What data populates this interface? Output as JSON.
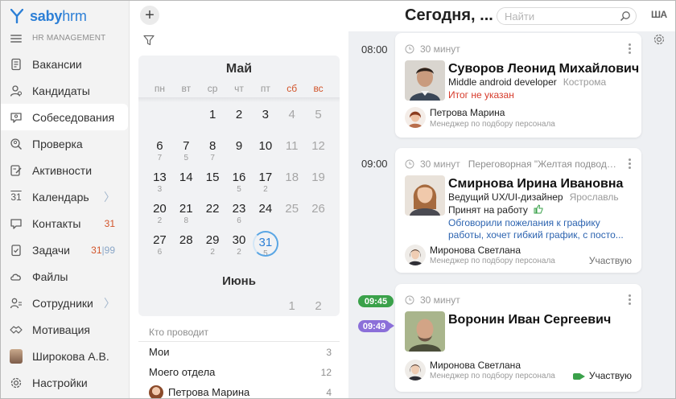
{
  "brand": {
    "name_bold": "saby",
    "name_rest": "hrm",
    "section": "HR MANAGEMENT",
    "color": "#2c7fd6"
  },
  "sidebar": {
    "items": [
      {
        "label": "Вакансии",
        "icon": "vacancy-icon"
      },
      {
        "label": "Кандидаты",
        "icon": "candidates-icon"
      },
      {
        "label": "Собеседования",
        "icon": "interviews-icon",
        "active": true
      },
      {
        "label": "Проверка",
        "icon": "check-icon"
      },
      {
        "label": "Активности",
        "icon": "activities-icon"
      },
      {
        "label": "Календарь",
        "icon": "calendar-icon",
        "icon_text": "31",
        "chevron": "〉"
      },
      {
        "label": "Контакты",
        "icon": "contacts-icon",
        "badge": "31"
      },
      {
        "label": "Задачи",
        "icon": "tasks-icon",
        "badge": "31",
        "badge2": "99"
      },
      {
        "label": "Файлы",
        "icon": "files-icon"
      },
      {
        "label": "Сотрудники",
        "icon": "employees-icon",
        "chevron": "〉"
      },
      {
        "label": "Мотивация",
        "icon": "motivation-icon"
      },
      {
        "label": "Широкова А.В.",
        "icon": "user-avatar"
      },
      {
        "label": "Настройки",
        "icon": "settings-icon"
      }
    ]
  },
  "calendar": {
    "month1": "Май",
    "month2": "Июнь",
    "weekdays": [
      "пн",
      "вт",
      "ср",
      "чт",
      "пт",
      "сб",
      "вс"
    ],
    "weeks": [
      [
        {
          "n": ""
        },
        {
          "n": ""
        },
        {
          "n": "1"
        },
        {
          "n": "2"
        },
        {
          "n": "3"
        },
        {
          "n": "4",
          "we": true
        },
        {
          "n": "5",
          "we": true
        }
      ],
      [
        {
          "n": "6",
          "c": "7"
        },
        {
          "n": "7",
          "c": "5"
        },
        {
          "n": "8",
          "c": "7"
        },
        {
          "n": "9"
        },
        {
          "n": "10"
        },
        {
          "n": "11",
          "we": true
        },
        {
          "n": "12",
          "we": true
        }
      ],
      [
        {
          "n": "13",
          "c": "3"
        },
        {
          "n": "14"
        },
        {
          "n": "15"
        },
        {
          "n": "16",
          "c": "5"
        },
        {
          "n": "17",
          "c": "2"
        },
        {
          "n": "18",
          "we": true
        },
        {
          "n": "19",
          "we": true
        }
      ],
      [
        {
          "n": "20",
          "c": "2"
        },
        {
          "n": "21",
          "c": "8"
        },
        {
          "n": "22"
        },
        {
          "n": "23",
          "c": "6"
        },
        {
          "n": "24"
        },
        {
          "n": "25",
          "we": true
        },
        {
          "n": "26",
          "we": true
        }
      ],
      [
        {
          "n": "27",
          "c": "6"
        },
        {
          "n": "28"
        },
        {
          "n": "29",
          "c": "2"
        },
        {
          "n": "30",
          "c": "2"
        },
        {
          "n": "31",
          "c": "5",
          "today": true
        },
        {
          "n": ""
        },
        {
          "n": ""
        }
      ]
    ],
    "june_days": [
      {
        "n": ""
      },
      {
        "n": ""
      },
      {
        "n": ""
      },
      {
        "n": ""
      },
      {
        "n": ""
      },
      {
        "n": "1",
        "we": true
      },
      {
        "n": "2",
        "we": true
      }
    ]
  },
  "conducts": {
    "title": "Кто проводит",
    "rows": [
      {
        "label": "Мои",
        "value": "3"
      },
      {
        "label": "Моего отдела",
        "value": "12"
      },
      {
        "label": "Петрова Марина",
        "value": "4",
        "avatar": true
      }
    ]
  },
  "header": {
    "title": "Сегодня, ...",
    "search_placeholder": "Найти",
    "lang": "ША"
  },
  "schedule": {
    "times": [
      "08:00",
      "09:00"
    ],
    "now_pill": "09:45",
    "next_pill": "09:49",
    "cards": [
      {
        "duration": "30 минут",
        "room": "",
        "name": "Суворов Леонид Михайлович",
        "position": "Middle android developer",
        "city": "Кострома",
        "status": "Итог не указан",
        "manager": "Петрова Марина",
        "manager_role": "Менеджер по подбору персонала",
        "participation": ""
      },
      {
        "duration": "30 минут",
        "room": "Переговорная \"Желтая подводн...",
        "name": "Смирнова Ирина Ивановна",
        "position": "Ведущий UX/UI-дизайнер",
        "city": "Ярославль",
        "status": "Принят на работу",
        "note": "Обговорили пожелания к графику работы, хочет гибкий график, с посто...",
        "manager": "Миронова Светлана",
        "manager_role": "Менеджер по подбору персонала",
        "participation": "Участвую"
      },
      {
        "duration": "30 минут",
        "room": "",
        "name": "Воронин Иван Сергеевич",
        "manager": "Миронова Светлана",
        "manager_role": "Менеджер по подбору персонала",
        "participation": "Участвую"
      }
    ]
  },
  "colors": {
    "accent": "#2c7fd6",
    "weekend": "#d2542a",
    "now": "#3aa14a",
    "next": "#8b6fd9",
    "error": "#d63a2a",
    "note": "#2d64b0"
  }
}
